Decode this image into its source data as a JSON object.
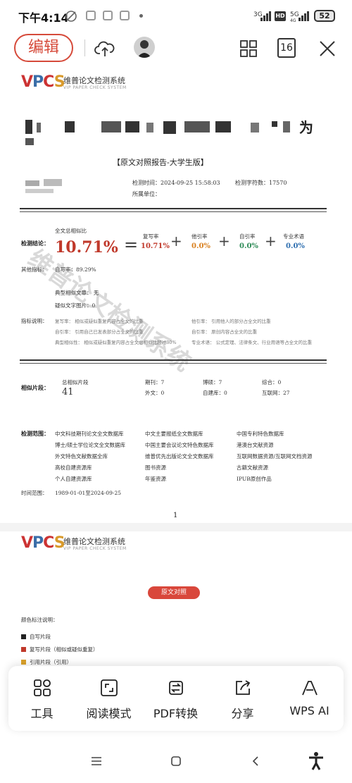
{
  "status_bar": {
    "time": "下午4:14",
    "signal_1": "3G",
    "hd": "HD",
    "signal_2": "5G",
    "signal_2_sub": "4G",
    "battery": "52"
  },
  "toolbar": {
    "edit_label": "编辑",
    "page_count": "16"
  },
  "document": {
    "logo_brand": "VPCS",
    "logo_cn": "维普论文检测系统",
    "logo_en": "VIP PAPER CHECK SYSTEM",
    "title_tail": "为",
    "subtitle": "【原文对照报告-大学生版】",
    "detect_time": "检测时间：2024-09-25 15:58:03",
    "word_count": "检测字符数：17570",
    "unit": "所属单位：",
    "conclusion_label": "检测结论：",
    "total_sim_label": "全文总相似比",
    "total_sim": "10.71%",
    "copy_rate_label": "复写率",
    "copy_rate": "10.71%",
    "other_rate_label": "他引率",
    "other_rate": "0.0%",
    "self_rate_label": "自引率",
    "self_rate": "0.0%",
    "term_label": "专业术语",
    "term_rate": "0.0%",
    "other_metrics_label": "其他指标：",
    "self_write": "自写率：89.29%",
    "typical_sim": "典型相似文章：  无",
    "suspect_image": "疑似文字图片：0",
    "explain_label": "指标说明：",
    "explain": [
      "复写率：  相似或疑似重复内容占全文的比重",
      "他引率：  引用他人的部分占全文的比重",
      "自引率：  引用自己已发表部分占全文的比重",
      "自引率：  原创内容占全文的比重",
      "典型相似性：  相似或疑似重复内容占全文总相似比超过30%",
      "专业术语：  公式定理、法律条文、行业用语等占全文的比重"
    ],
    "segment_label": "相似片段：",
    "total_segments_label": "总相似片段",
    "total_segments": "41",
    "journal": "期刊：7",
    "thesis": "博硕：7",
    "synthesis": "综合：0",
    "foreign": "外文：0",
    "self_built": "自建库：0",
    "internet": "互联网：27",
    "scope_label": "检测范围：",
    "scope": [
      "中文科技期刊论文全文数据库",
      "中文主要报纸全文数据库",
      "中国专利特色数据库",
      "博士/硕士学位论文全文数据库",
      "中国主要会议论文特色数据库",
      "港澳台文献资源",
      "外文特色文献数据全库",
      "维普优先出版论文全文数据库",
      "互联网数据资源/互联网文档资源",
      "高校自建资源库",
      "图书资源",
      "古籍文献资源",
      "个人自建资源库",
      "年鉴资源",
      "IPUB原创作品"
    ],
    "time_range_label": "时间范围：",
    "time_range": "1989-01-01至2024-09-25",
    "page_number": "1",
    "page2_button": "原文对照",
    "color_legend_title": "颜色标注说明：",
    "legend": [
      "自写片段",
      "复写片段（相似或疑似重复）",
      "引用片段（引用）"
    ],
    "colors": {
      "accent": "#d9473b",
      "self_write": "#222222",
      "copy": "#c0392b",
      "quote": "#d9a12b"
    }
  },
  "bottom_menu": [
    {
      "label": "工具",
      "icon": "tools-grid-icon"
    },
    {
      "label": "阅读模式",
      "icon": "expand-icon"
    },
    {
      "label": "PDF转换",
      "icon": "pdf-convert-icon"
    },
    {
      "label": "分享",
      "icon": "share-icon"
    },
    {
      "label": "WPS AI",
      "icon": "wps-ai-icon"
    }
  ]
}
